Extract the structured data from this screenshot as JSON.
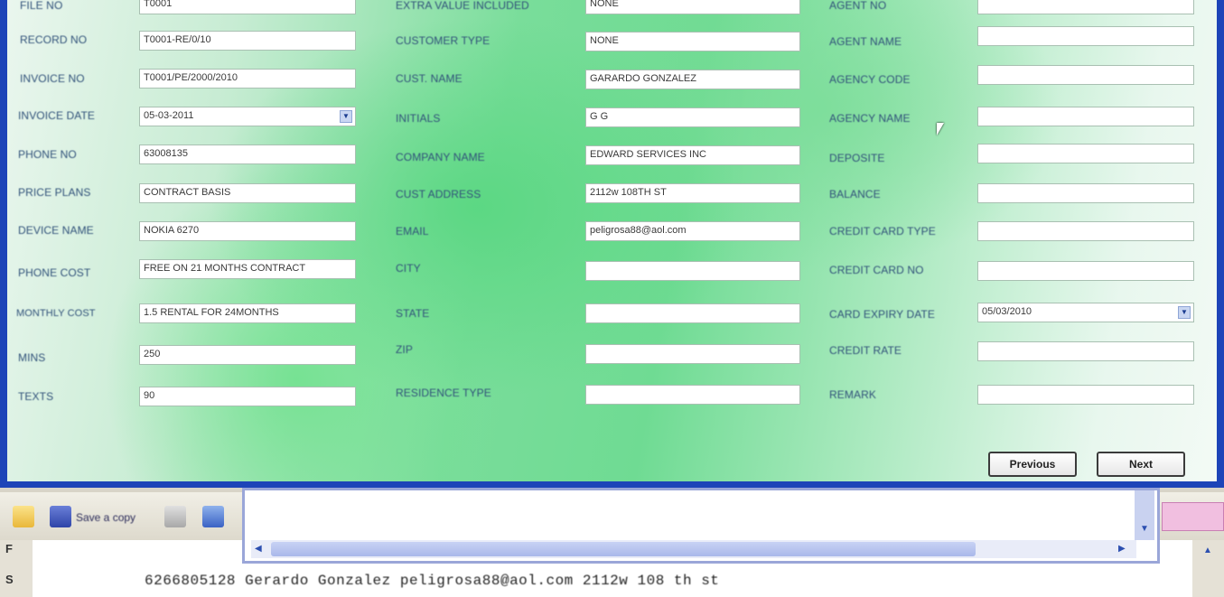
{
  "form": {
    "col1": [
      {
        "label": "FILE NO",
        "value": "T0001"
      },
      {
        "label": "RECORD NO",
        "value": "T0001-RE/0/10"
      },
      {
        "label": "INVOICE NO",
        "value": "T0001/PE/2000/2010"
      },
      {
        "label": "INVOICE DATE",
        "value": "05-03-2011"
      },
      {
        "label": "PHONE NO",
        "value": "63008135"
      },
      {
        "label": "PRICE PLANS",
        "value": "CONTRACT BASIS"
      },
      {
        "label": "DEVICE NAME",
        "value": "NOKIA 6270"
      },
      {
        "label": "PHONE COST",
        "value": "FREE ON 21 MONTHS CONTRACT"
      },
      {
        "label": "MONTHLY COST",
        "value": "1.5 RENTAL FOR 24MONTHS"
      },
      {
        "label": "MINS",
        "value": "250"
      },
      {
        "label": "TEXTS",
        "value": "90"
      }
    ],
    "col2": [
      {
        "label": "EXTRA VALUE INCLUDED",
        "value": "NONE"
      },
      {
        "label": "CUSTOMER TYPE",
        "value": "NONE"
      },
      {
        "label": "CUST. NAME",
        "value": "GARARDO GONZALEZ"
      },
      {
        "label": "INITIALS",
        "value": "G G"
      },
      {
        "label": "COMPANY NAME",
        "value": "EDWARD SERVICES INC"
      },
      {
        "label": "CUST ADDRESS",
        "value": "2112w 108TH ST"
      },
      {
        "label": "EMAIL",
        "value": "peligrosa88@aol.com"
      },
      {
        "label": "CITY",
        "value": ""
      },
      {
        "label": "STATE",
        "value": ""
      },
      {
        "label": "ZIP",
        "value": ""
      },
      {
        "label": "RESIDENCE TYPE",
        "value": ""
      }
    ],
    "col3": [
      {
        "label": "AGENT NO",
        "value": ""
      },
      {
        "label": "AGENT NAME",
        "value": ""
      },
      {
        "label": "AGENCY CODE",
        "value": ""
      },
      {
        "label": "AGENCY NAME",
        "value": ""
      },
      {
        "label": "DEPOSITE",
        "value": ""
      },
      {
        "label": "BALANCE",
        "value": ""
      },
      {
        "label": "CREDIT CARD TYPE",
        "value": ""
      },
      {
        "label": "CREDIT CARD NO",
        "value": ""
      },
      {
        "label": "CARD EXPIRY DATE",
        "value": "05/03/2010"
      },
      {
        "label": "CREDIT RATE",
        "value": ""
      },
      {
        "label": "REMARK",
        "value": ""
      }
    ],
    "buttons": {
      "previous": "Previous",
      "next": "Next"
    }
  },
  "toolbar": {
    "save_label": "Save a copy"
  },
  "document": {
    "line1": "6266805128      Gerardo Gonzalez      peligrosa88@aol.com      2112w 108 th st",
    "line2": "        ",
    "gutter_top": "F",
    "gutter_bottom": "S"
  },
  "colors": {
    "dialog_border": "#1d44b8",
    "panel_green": "#6fdb93"
  }
}
